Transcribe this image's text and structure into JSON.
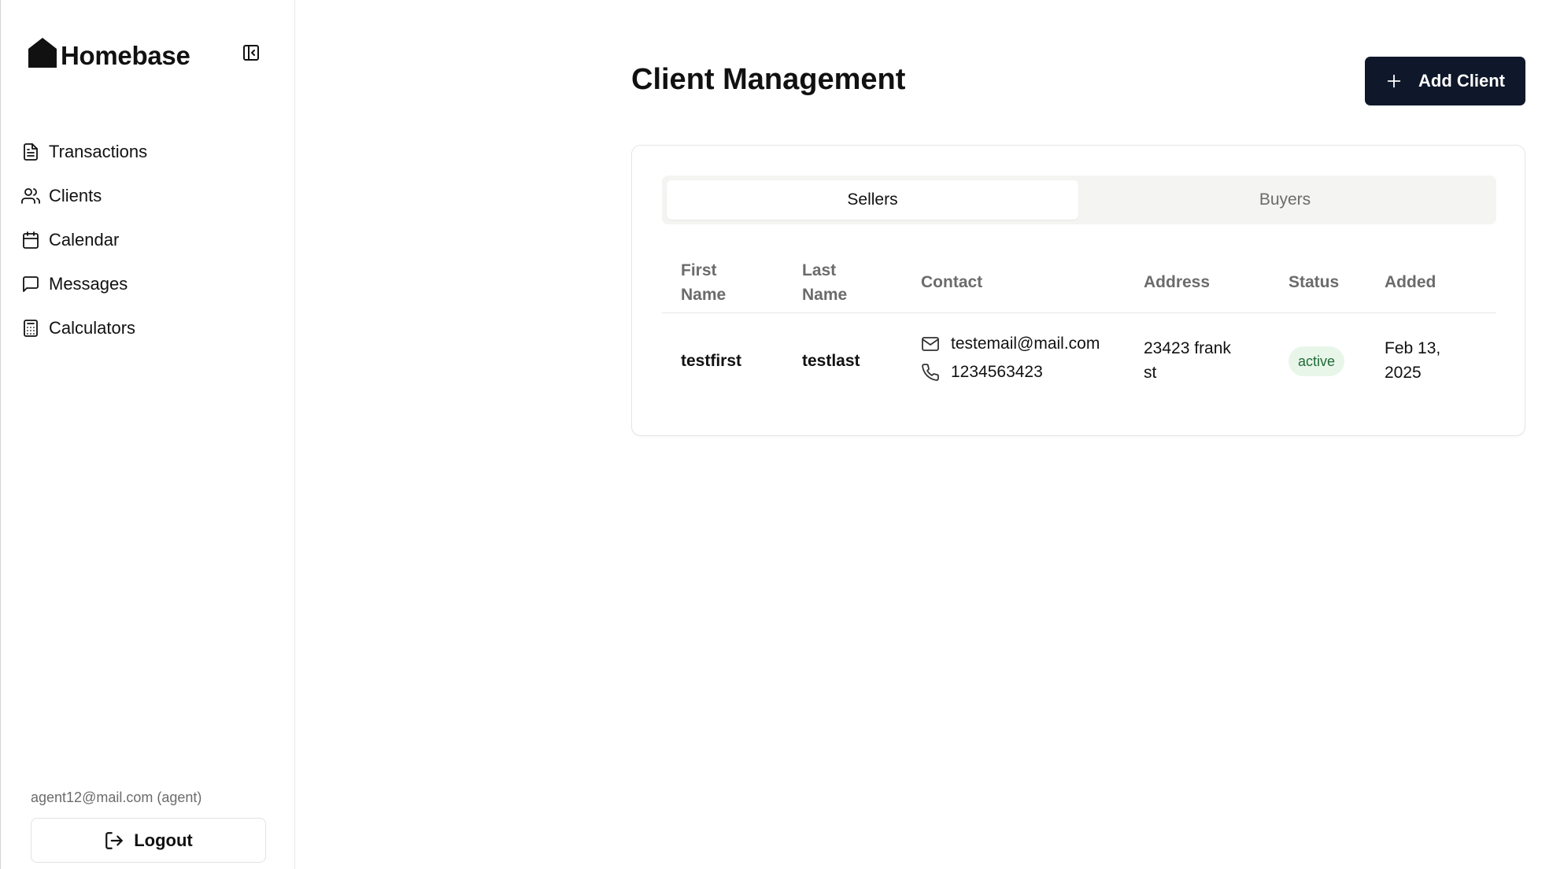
{
  "brand": {
    "name": "Homebase",
    "logo_icon": "house-icon"
  },
  "sidebar": {
    "collapse_icon": "sidebar-collapse-icon",
    "items": [
      {
        "label": "Transactions",
        "icon": "file-text-icon"
      },
      {
        "label": "Clients",
        "icon": "users-icon"
      },
      {
        "label": "Calendar",
        "icon": "calendar-icon"
      },
      {
        "label": "Messages",
        "icon": "message-square-icon"
      },
      {
        "label": "Calculators",
        "icon": "calculator-icon"
      }
    ],
    "user_email": "agent12@mail.com (agent)",
    "logout_label": "Logout"
  },
  "main": {
    "title": "Client Management",
    "add_button_label": "Add Client",
    "tabs": [
      {
        "label": "Sellers",
        "active": true
      },
      {
        "label": "Buyers",
        "active": false
      }
    ],
    "table": {
      "headers": {
        "first_name": [
          "First",
          "Name"
        ],
        "last_name": [
          "Last",
          "Name"
        ],
        "contact": "Contact",
        "address": "Address",
        "status": "Status",
        "added": "Added"
      },
      "rows": [
        {
          "first_name": "testfirst",
          "last_name": "testlast",
          "email": "testemail@mail.com",
          "phone": "1234563423",
          "address": [
            "23423 frank",
            "st"
          ],
          "status": "active",
          "added": [
            "Feb 13,",
            "2025"
          ]
        }
      ]
    }
  },
  "colors": {
    "primary_button": "#0f172a",
    "status_active_bg": "#e8f6ea",
    "status_active_text": "#1f6b35",
    "tab_bar_bg": "#f4f4f3"
  }
}
